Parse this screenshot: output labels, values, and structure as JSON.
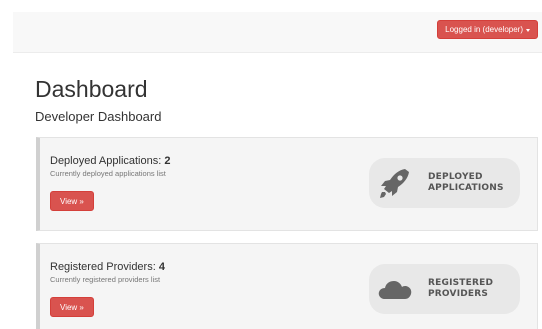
{
  "header": {
    "user_menu_label": "Logged in (developer)"
  },
  "page": {
    "title": "Dashboard",
    "subtitle": "Developer Dashboard"
  },
  "panels": [
    {
      "heading": "Deployed Applications:",
      "count": "2",
      "description": "Currently deployed applications list",
      "button_label": "View »",
      "badge_line1": "DEPLOYED",
      "badge_line2": "APPLICATIONS",
      "icon": "rocket-icon"
    },
    {
      "heading": "Registered Providers:",
      "count": "4",
      "description": "Currently registered providers list",
      "button_label": "View »",
      "badge_line1": "REGISTERED",
      "badge_line2": "PROVIDERS",
      "icon": "cloud-icon"
    }
  ],
  "colors": {
    "accent": "#d9534f",
    "panel_bg": "#f5f5f5",
    "badge_bg": "#e8e8e8",
    "icon": "#666666"
  }
}
